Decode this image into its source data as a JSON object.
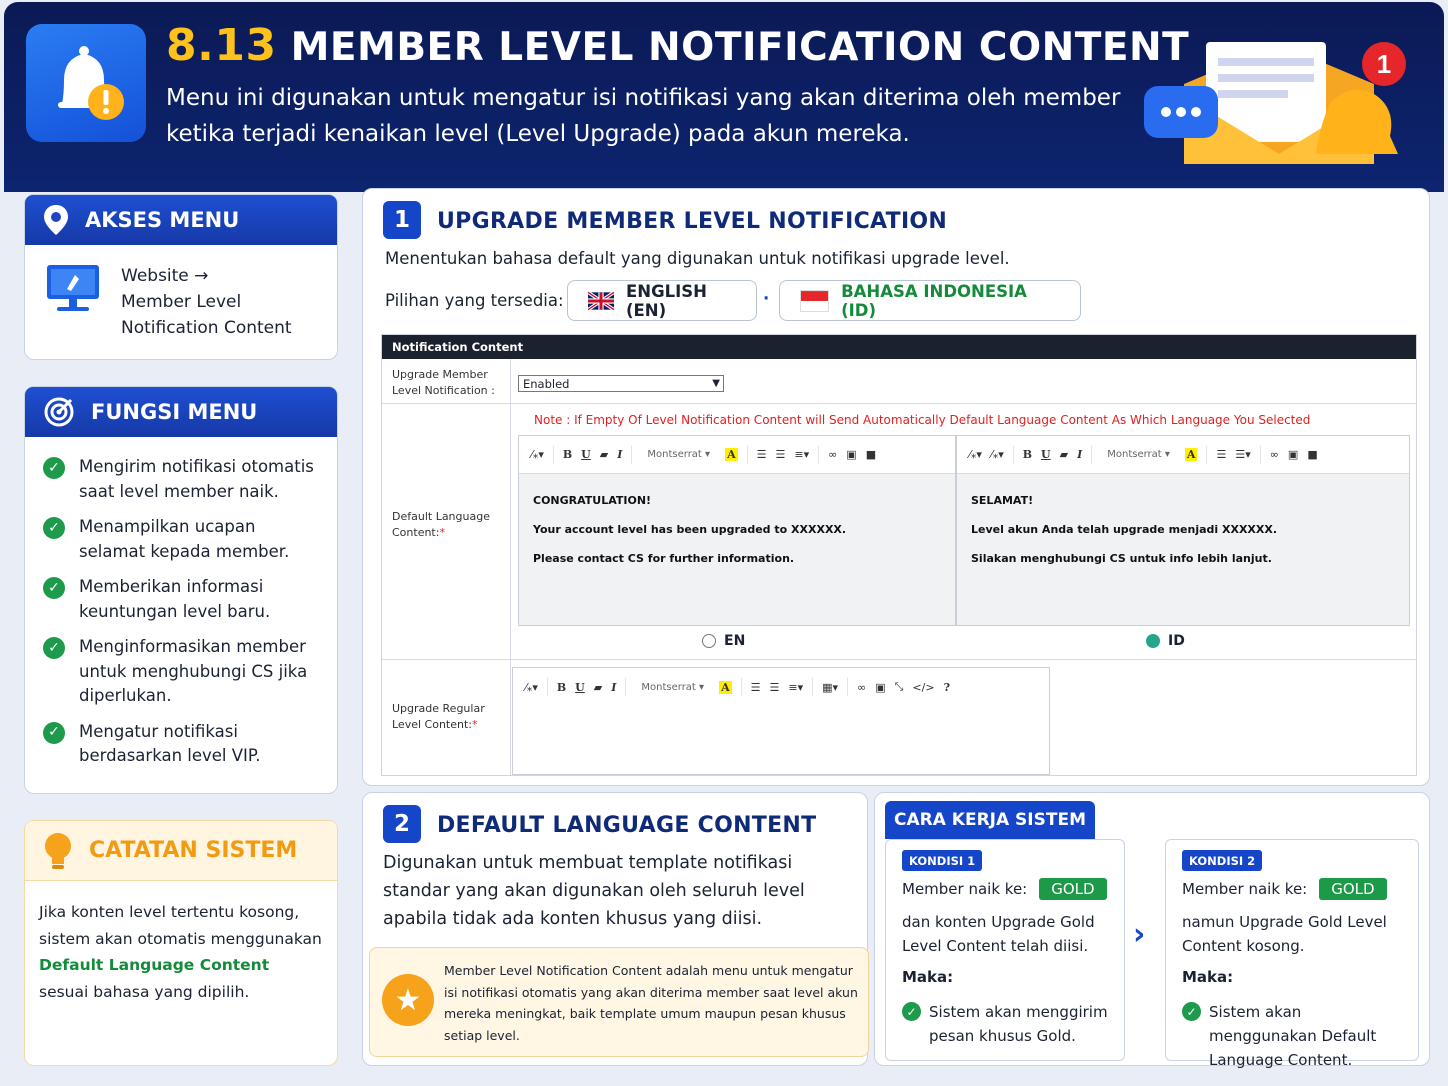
{
  "header": {
    "number": "8.13",
    "title": "MEMBER LEVEL NOTIFICATION CONTENT",
    "description": "Menu ini digunakan untuk mengatur isi notifikasi yang akan diterima oleh member ketika terjadi kenaikan level (Level Upgrade) pada akun mereka.",
    "badge_count": "1"
  },
  "akses_menu": {
    "title": "AKSES MENU",
    "path": [
      "Website →",
      "Member Level",
      "Notification Content"
    ]
  },
  "fungsi_menu": {
    "title": "FUNGSI MENU",
    "items": [
      "Mengirim notifikasi otomatis saat level member naik.",
      "Menampilkan ucapan selamat kepada member.",
      "Memberikan informasi keuntungan level baru.",
      "Menginformasikan member untuk menghubungi CS jika diperlukan.",
      "Mengatur notifikasi berdasarkan level VIP."
    ]
  },
  "catatan": {
    "title": "CATATAN SISTEM",
    "text_before": "Jika konten level tertentu kosong, sistem akan otomatis menggunakan ",
    "highlight": "Default Language Content",
    "text_after": " sesuai bahasa yang dipilih."
  },
  "section1": {
    "number": "1",
    "title": "UPGRADE MEMBER LEVEL NOTIFICATION",
    "desc": "Menentukan bahasa default yang digunakan untuk notifikasi upgrade level.",
    "options_label": "Pilihan yang tersedia:",
    "lang_en": "ENGLISH (EN)",
    "lang_sep": "·",
    "lang_id": "BAHASA INDONESIA (ID)",
    "form": {
      "header": "Notification Content",
      "row1_label": "Upgrade Member Level Notification :",
      "row1_value": "Enabled",
      "note": "Note : If Empty Of Level Notification Content will Send Automatically Default Language Content As Which Language You Selected",
      "row2_label": "Default Language Content:",
      "required": "*",
      "font_name": "Montserrat",
      "en_content": [
        "CONGRATULATION!",
        "Your account level has been upgraded to XXXXXX.",
        "Please contact CS for further information."
      ],
      "id_content": [
        "SELAMAT!",
        "Level akun Anda telah upgrade menjadi XXXXXX.",
        "Silakan menghubungi CS untuk info lebih lanjut."
      ],
      "radio_en": "EN",
      "radio_id": "ID",
      "radio_selected": "ID",
      "row3_label": "Upgrade Regular Level Content:"
    }
  },
  "section2": {
    "number": "2",
    "title": "DEFAULT LANGUAGE CONTENT",
    "desc": "Digunakan untuk membuat template notifikasi standar yang akan digunakan oleh seluruh level apabila tidak ada konten khusus yang diisi.",
    "info": "Member Level Notification Content adalah menu untuk mengatur isi notifikasi otomatis yang akan diterima member saat level akun mereka meningkat, baik template umum maupun pesan khusus setiap level."
  },
  "cara_kerja": {
    "title": "CARA KERJA SISTEM",
    "kondisi": [
      {
        "badge": "KONDISI 1",
        "naik": "Member naik ke:",
        "level": "GOLD",
        "desc": "dan konten Upgrade Gold Level Content telah diisi.",
        "maka": "Maka:",
        "result": "Sistem akan menggirim pesan khusus Gold."
      },
      {
        "badge": "KONDISI 2",
        "naik": "Member naik ke:",
        "level": "GOLD",
        "desc": "namun Upgrade Gold Level Content kosong.",
        "maka": "Maka:",
        "result": "Sistem akan menggunakan Default Language Content."
      }
    ]
  },
  "colors": {
    "primary": "#1545c8",
    "header_bg": "#0b1a55",
    "accent_yellow": "#ffc21a",
    "success": "#1d9a4b",
    "danger": "#e0211f"
  }
}
